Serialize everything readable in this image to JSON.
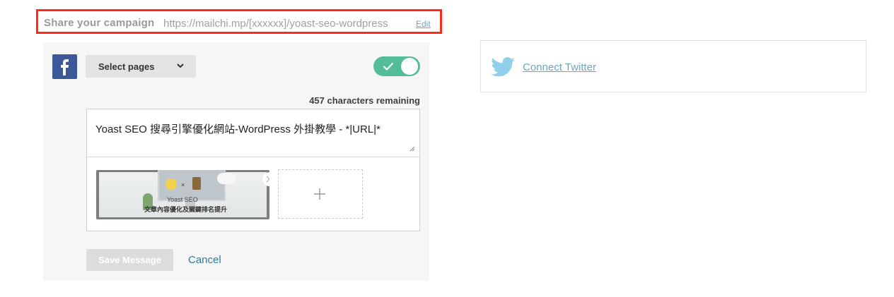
{
  "share": {
    "label": "Share your campaign",
    "url": "https://mailchi.mp/[xxxxxx]/yoast-seo-wordpress",
    "edit_label": "Edit"
  },
  "facebook": {
    "icon": "facebook-icon",
    "select_pages_label": "Select pages",
    "toggle_on": true,
    "characters_remaining": "457 characters remaining",
    "message": "Yoast SEO 搜尋引擎優化網站-WordPress 外掛教學 - *|URL|*",
    "thumbnail": {
      "brand": "Yoast SEO",
      "caption": "文章內容優化及關鍵排名提升",
      "separator": "×"
    },
    "add_image_icon": "plus-icon",
    "save_label": "Save Message",
    "cancel_label": "Cancel"
  },
  "twitter": {
    "icon": "twitter-bird-icon",
    "connect_label": "Connect Twitter"
  },
  "colors": {
    "highlight_border": "#ff2a1a",
    "facebook_blue": "#3b5998",
    "toggle_green": "#52bd98",
    "link_teal": "#2f7a93",
    "twitter_blue": "#55acee"
  }
}
